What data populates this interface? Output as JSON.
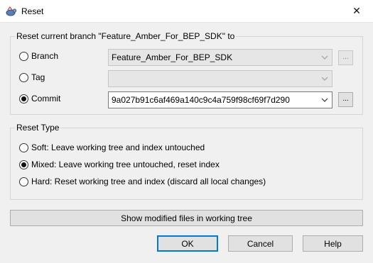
{
  "window": {
    "title": "Reset",
    "close_glyph": "✕",
    "icon": "tortoise-app-icon"
  },
  "branch_group": {
    "title": "Reset current branch \"Feature_Amber_For_BEP_SDK\" to",
    "branch": {
      "label": "Branch",
      "selected": false,
      "value": "Feature_Amber_For_BEP_SDK",
      "enabled": false,
      "browse": "..."
    },
    "tag": {
      "label": "Tag",
      "selected": false,
      "value": "",
      "enabled": false
    },
    "commit": {
      "label": "Commit",
      "selected": true,
      "value": "9a027b91c6af469a140c9c4a759f98cf69f7d290",
      "enabled": true,
      "browse": "..."
    }
  },
  "reset_type": {
    "title": "Reset Type",
    "options": [
      {
        "label": "Soft: Leave working tree and index untouched",
        "selected": false
      },
      {
        "label": "Mixed: Leave working tree untouched, reset index",
        "selected": true
      },
      {
        "label": "Hard: Reset working tree and index (discard all local changes)",
        "selected": false
      }
    ]
  },
  "show_modified_label": "Show modified files in working tree",
  "buttons": {
    "ok": "OK",
    "cancel": "Cancel",
    "help": "Help"
  },
  "colors": {
    "accent": "#0078d7",
    "window_bg": "#f0f0f0"
  }
}
